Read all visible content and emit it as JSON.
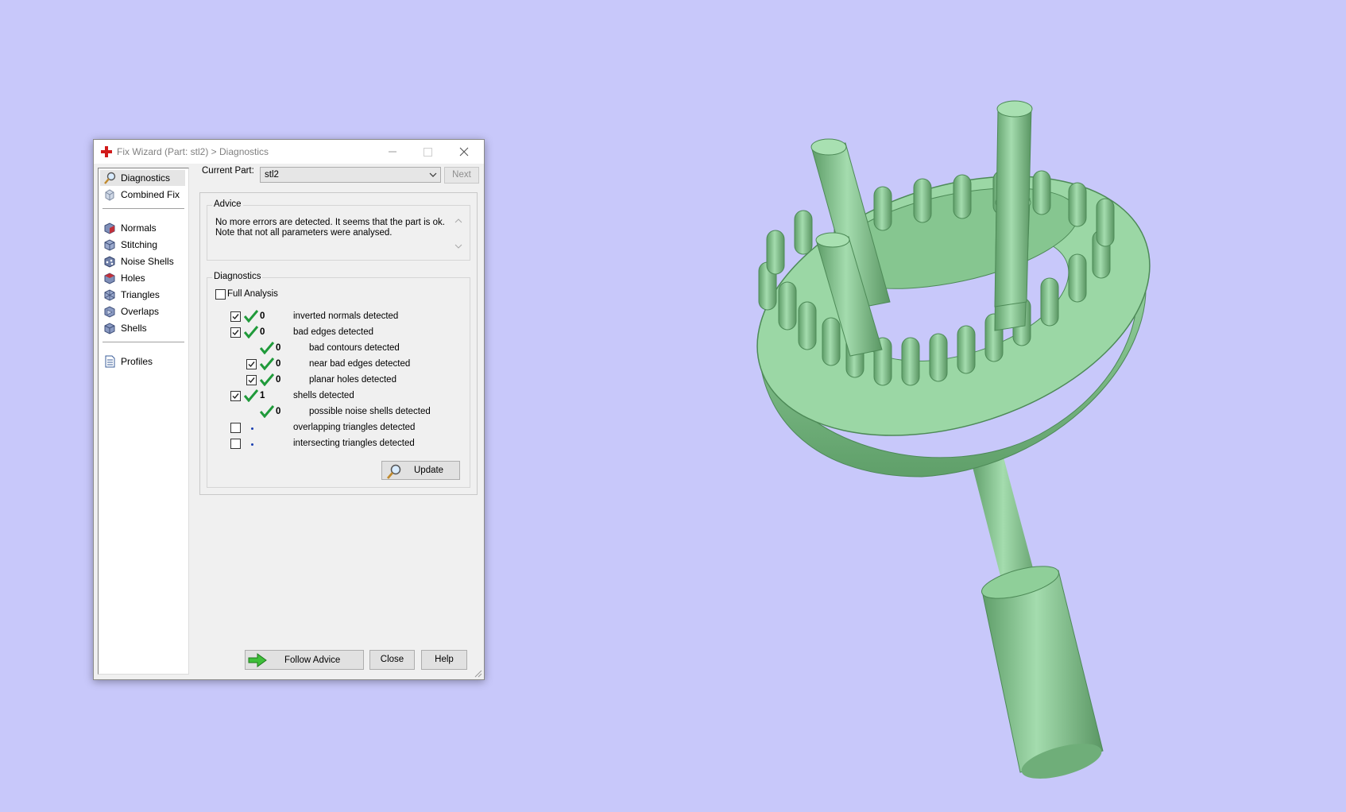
{
  "dialog": {
    "title": "Fix Wizard (Part: stl2) > Diagnostics"
  },
  "sidebar": {
    "items": [
      {
        "label": "Diagnostics",
        "icon": "magnifier-icon",
        "selected": true
      },
      {
        "label": "Combined Fix",
        "icon": "cube-icon"
      },
      {
        "label": "Normals",
        "icon": "normals-cube-icon"
      },
      {
        "label": "Stitching",
        "icon": "stitching-cube-icon"
      },
      {
        "label": "Noise Shells",
        "icon": "noise-shells-icon"
      },
      {
        "label": "Holes",
        "icon": "holes-cube-icon"
      },
      {
        "label": "Triangles",
        "icon": "triangles-cube-icon"
      },
      {
        "label": "Overlaps",
        "icon": "overlaps-cube-icon"
      },
      {
        "label": "Shells",
        "icon": "shells-cube-icon"
      },
      {
        "label": "Profiles",
        "icon": "profiles-document-icon"
      }
    ]
  },
  "header": {
    "current_part_label": "Current Part:",
    "current_part_value": "stl2",
    "next_label": "Next"
  },
  "advice": {
    "title": "Advice",
    "line1": "No more errors are detected. It seems that the part is ok.",
    "line2": "Note that not all parameters were analysed."
  },
  "diagnostics": {
    "title": "Diagnostics",
    "full_analysis_label": "Full Analysis",
    "full_analysis_checked": false,
    "rows": [
      {
        "checked": true,
        "status": "ok",
        "count": "0",
        "label": "inverted normals detected",
        "indent": 0
      },
      {
        "checked": true,
        "status": "ok",
        "count": "0",
        "label": "bad edges detected",
        "indent": 0
      },
      {
        "checked": null,
        "status": "ok",
        "count": "0",
        "label": "bad contours detected",
        "indent": 1
      },
      {
        "checked": true,
        "status": "ok",
        "count": "0",
        "label": "near bad edges detected",
        "indent": 1
      },
      {
        "checked": true,
        "status": "ok",
        "count": "0",
        "label": "planar holes detected",
        "indent": 1
      },
      {
        "checked": true,
        "status": "ok",
        "count": "1",
        "label": "shells detected",
        "indent": 0
      },
      {
        "checked": null,
        "status": "ok",
        "count": "0",
        "label": "possible noise shells detected",
        "indent": 1
      },
      {
        "checked": false,
        "status": "pending",
        "count": "",
        "label": "overlapping triangles detected",
        "indent": 0
      },
      {
        "checked": false,
        "status": "pending",
        "count": "",
        "label": "intersecting triangles detected",
        "indent": 0
      }
    ],
    "update_label": "Update"
  },
  "footer": {
    "follow_advice_label": "Follow Advice",
    "close_label": "Close",
    "help_label": "Help"
  },
  "colors": {
    "background": "#c8c8fa",
    "model": "#8fd19a",
    "model_shadow": "#4f8f5a",
    "check": "#1f9a3a"
  }
}
